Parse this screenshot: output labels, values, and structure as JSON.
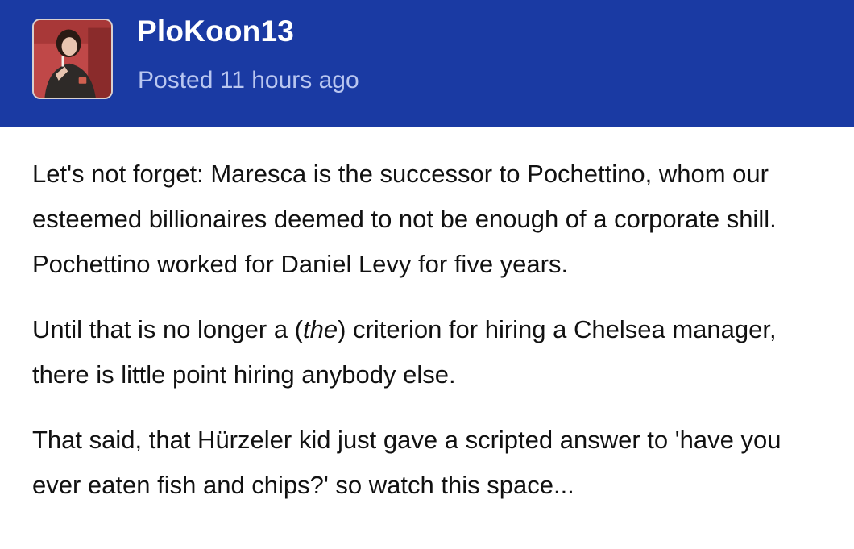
{
  "post": {
    "username": "PloKoon13",
    "posted": "Posted 11 hours ago",
    "avatar_icon": "user-avatar-photo",
    "paragraphs": {
      "p1": "Let's not forget: Maresca is the successor to Pochettino, whom our esteemed billionaires deemed to not be enough of a corporate shill. Pochettino worked for Daniel Levy for five years.",
      "p2_before": "Until that is no longer a (",
      "p2_em": "the",
      "p2_after": ") criterion for hiring a Chelsea manager, there is little point hiring anybody else.",
      "p3": "That said, that Hürzeler kid just gave a scripted answer to 'have you ever eaten fish and chips?' so watch this space..."
    }
  },
  "colors": {
    "header_bg": "#1a3aa3",
    "username": "#ffffff",
    "posted_text": "#b9c6f0",
    "body_text": "#111111"
  }
}
